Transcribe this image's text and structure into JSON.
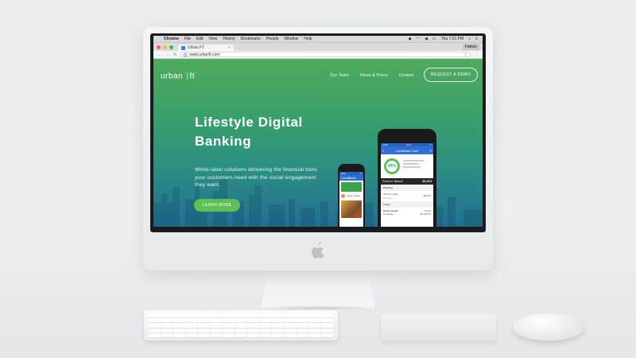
{
  "os_menu": {
    "apple_symbol": "",
    "items": [
      "Chrome",
      "File",
      "Edit",
      "View",
      "History",
      "Bookmarks",
      "People",
      "Window",
      "Help"
    ],
    "clock": "Thu 7:21 PM"
  },
  "browser": {
    "tab_title": "Urban FT",
    "tab_close": "×",
    "profile_name": "Fabian",
    "url": "www.urbanft.com",
    "back": "←",
    "forward": "→",
    "reload": "↻",
    "star": "☆",
    "menu": "⋮"
  },
  "site": {
    "logo_text": "urban",
    "logo_suffix": "ft",
    "nav": [
      "Our Team",
      "News & Press",
      "Contact"
    ],
    "cta_demo": "REQUEST A DEMO",
    "headline_1": "Lifestyle Digital",
    "headline_2": "Banking",
    "subtext": "White-label solutions delivering the financial tools your customers need with the social engagement they want.",
    "cta_learn": "LEARN MORE"
  },
  "phone_front": {
    "app_title": "LocalBank Card",
    "score": "95%",
    "good_to_spend_label": "Good to Spend",
    "good_to_spend_value": "$2,313",
    "pending_header": "Pending",
    "pending_item": "Whitney Card",
    "pending_status": "Pending",
    "pending_amount": "-$93.00",
    "today_header": "Today",
    "today_item": "Duane Reade",
    "today_sub": "Purchase",
    "today_amount": "-$9.00",
    "today_balance": "$2,428.32"
  },
  "phone_back": {
    "app_title": "LocalBank",
    "person": "Casey Taylor"
  },
  "colors": {
    "brand_green": "#5cc054",
    "gradient_top": "#4faa5c",
    "gradient_bottom": "#236f93",
    "app_blue": "#2f6fd1"
  }
}
